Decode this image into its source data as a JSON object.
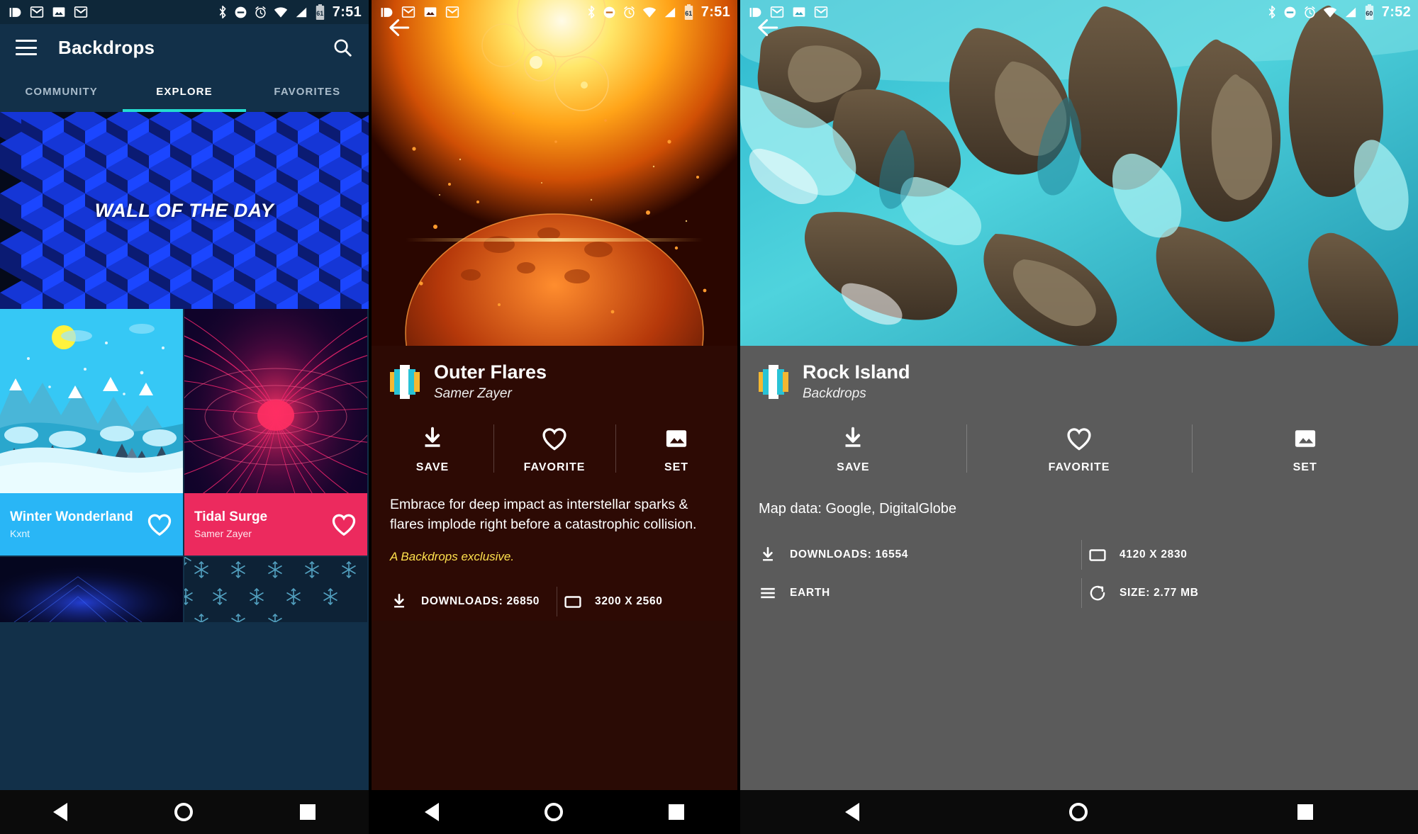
{
  "statusbars": {
    "left_icons": [
      "pushbullet-icon",
      "gmail-icon",
      "photos-icon",
      "gmail-icon"
    ],
    "right_icons": [
      "bluetooth-icon",
      "do-not-disturb-icon",
      "alarm-icon",
      "wifi-icon",
      "signal-icon",
      "battery-icon"
    ],
    "screen1": {
      "time": "7:51",
      "battery": "61"
    },
    "screen2": {
      "time": "7:51",
      "battery": "61"
    },
    "screen3": {
      "time": "7:52",
      "battery": "60"
    }
  },
  "browse": {
    "app_title": "Backdrops",
    "menu_icon": "hamburger-menu-icon",
    "search_icon": "search-icon",
    "tabs": [
      {
        "label": "COMMUNITY",
        "active": false
      },
      {
        "label": "EXPLORE",
        "active": true
      },
      {
        "label": "FAVORITES",
        "active": false
      }
    ],
    "accent_color": "#24dcd0",
    "toolbar_color": "#123049",
    "wall_of_the_day": {
      "label": "WALL OF THE DAY"
    },
    "tiles": [
      {
        "title": "Winter Wonderland",
        "author": "Kxnt",
        "bar_color": "#29b6f6",
        "favorite_icon": "heart-outline-icon"
      },
      {
        "title": "Tidal Surge",
        "author": "Samer Zayer",
        "bar_color": "#ec2a5e",
        "favorite_icon": "heart-outline-icon"
      }
    ]
  },
  "detail_outer_flares": {
    "back_icon": "back-arrow-icon",
    "logo_icon": "backdrops-logo-icon",
    "title": "Outer Flares",
    "author": "Samer Zayer",
    "actions": [
      {
        "label": "SAVE",
        "icon": "download-icon"
      },
      {
        "label": "FAVORITE",
        "icon": "heart-outline-icon"
      },
      {
        "label": "SET",
        "icon": "image-icon"
      }
    ],
    "description": "Embrace for deep impact as interstellar sparks & flares implode right before a catastrophic collision.",
    "exclusive_note": "A Backdrops exclusive.",
    "exclusive_color": "#ffe14d",
    "meta": [
      {
        "icon": "download-icon",
        "label": "DOWNLOADS: 26850"
      },
      {
        "icon": "resolution-icon",
        "label": "3200 X 2560"
      }
    ],
    "background_color": "#2d0a04"
  },
  "detail_rock_island": {
    "back_icon": "back-arrow-icon",
    "logo_icon": "backdrops-logo-icon",
    "title": "Rock Island",
    "author": "Backdrops",
    "actions": [
      {
        "label": "SAVE",
        "icon": "download-icon"
      },
      {
        "label": "FAVORITE",
        "icon": "heart-outline-icon"
      },
      {
        "label": "SET",
        "icon": "image-icon"
      }
    ],
    "map_data": "Map data: Google, DigitalGlobe",
    "meta": [
      {
        "icon": "download-icon",
        "label": "DOWNLOADS: 16554"
      },
      {
        "icon": "resolution-icon",
        "label": "4120 X 2830"
      },
      {
        "icon": "category-icon",
        "label": "EARTH"
      },
      {
        "icon": "size-icon",
        "label": "SIZE: 2.77 MB"
      }
    ],
    "background_color": "#5b5b5b"
  },
  "navbar": {
    "back": "back-triangle-icon",
    "home": "home-circle-icon",
    "recents": "recents-square-icon"
  }
}
